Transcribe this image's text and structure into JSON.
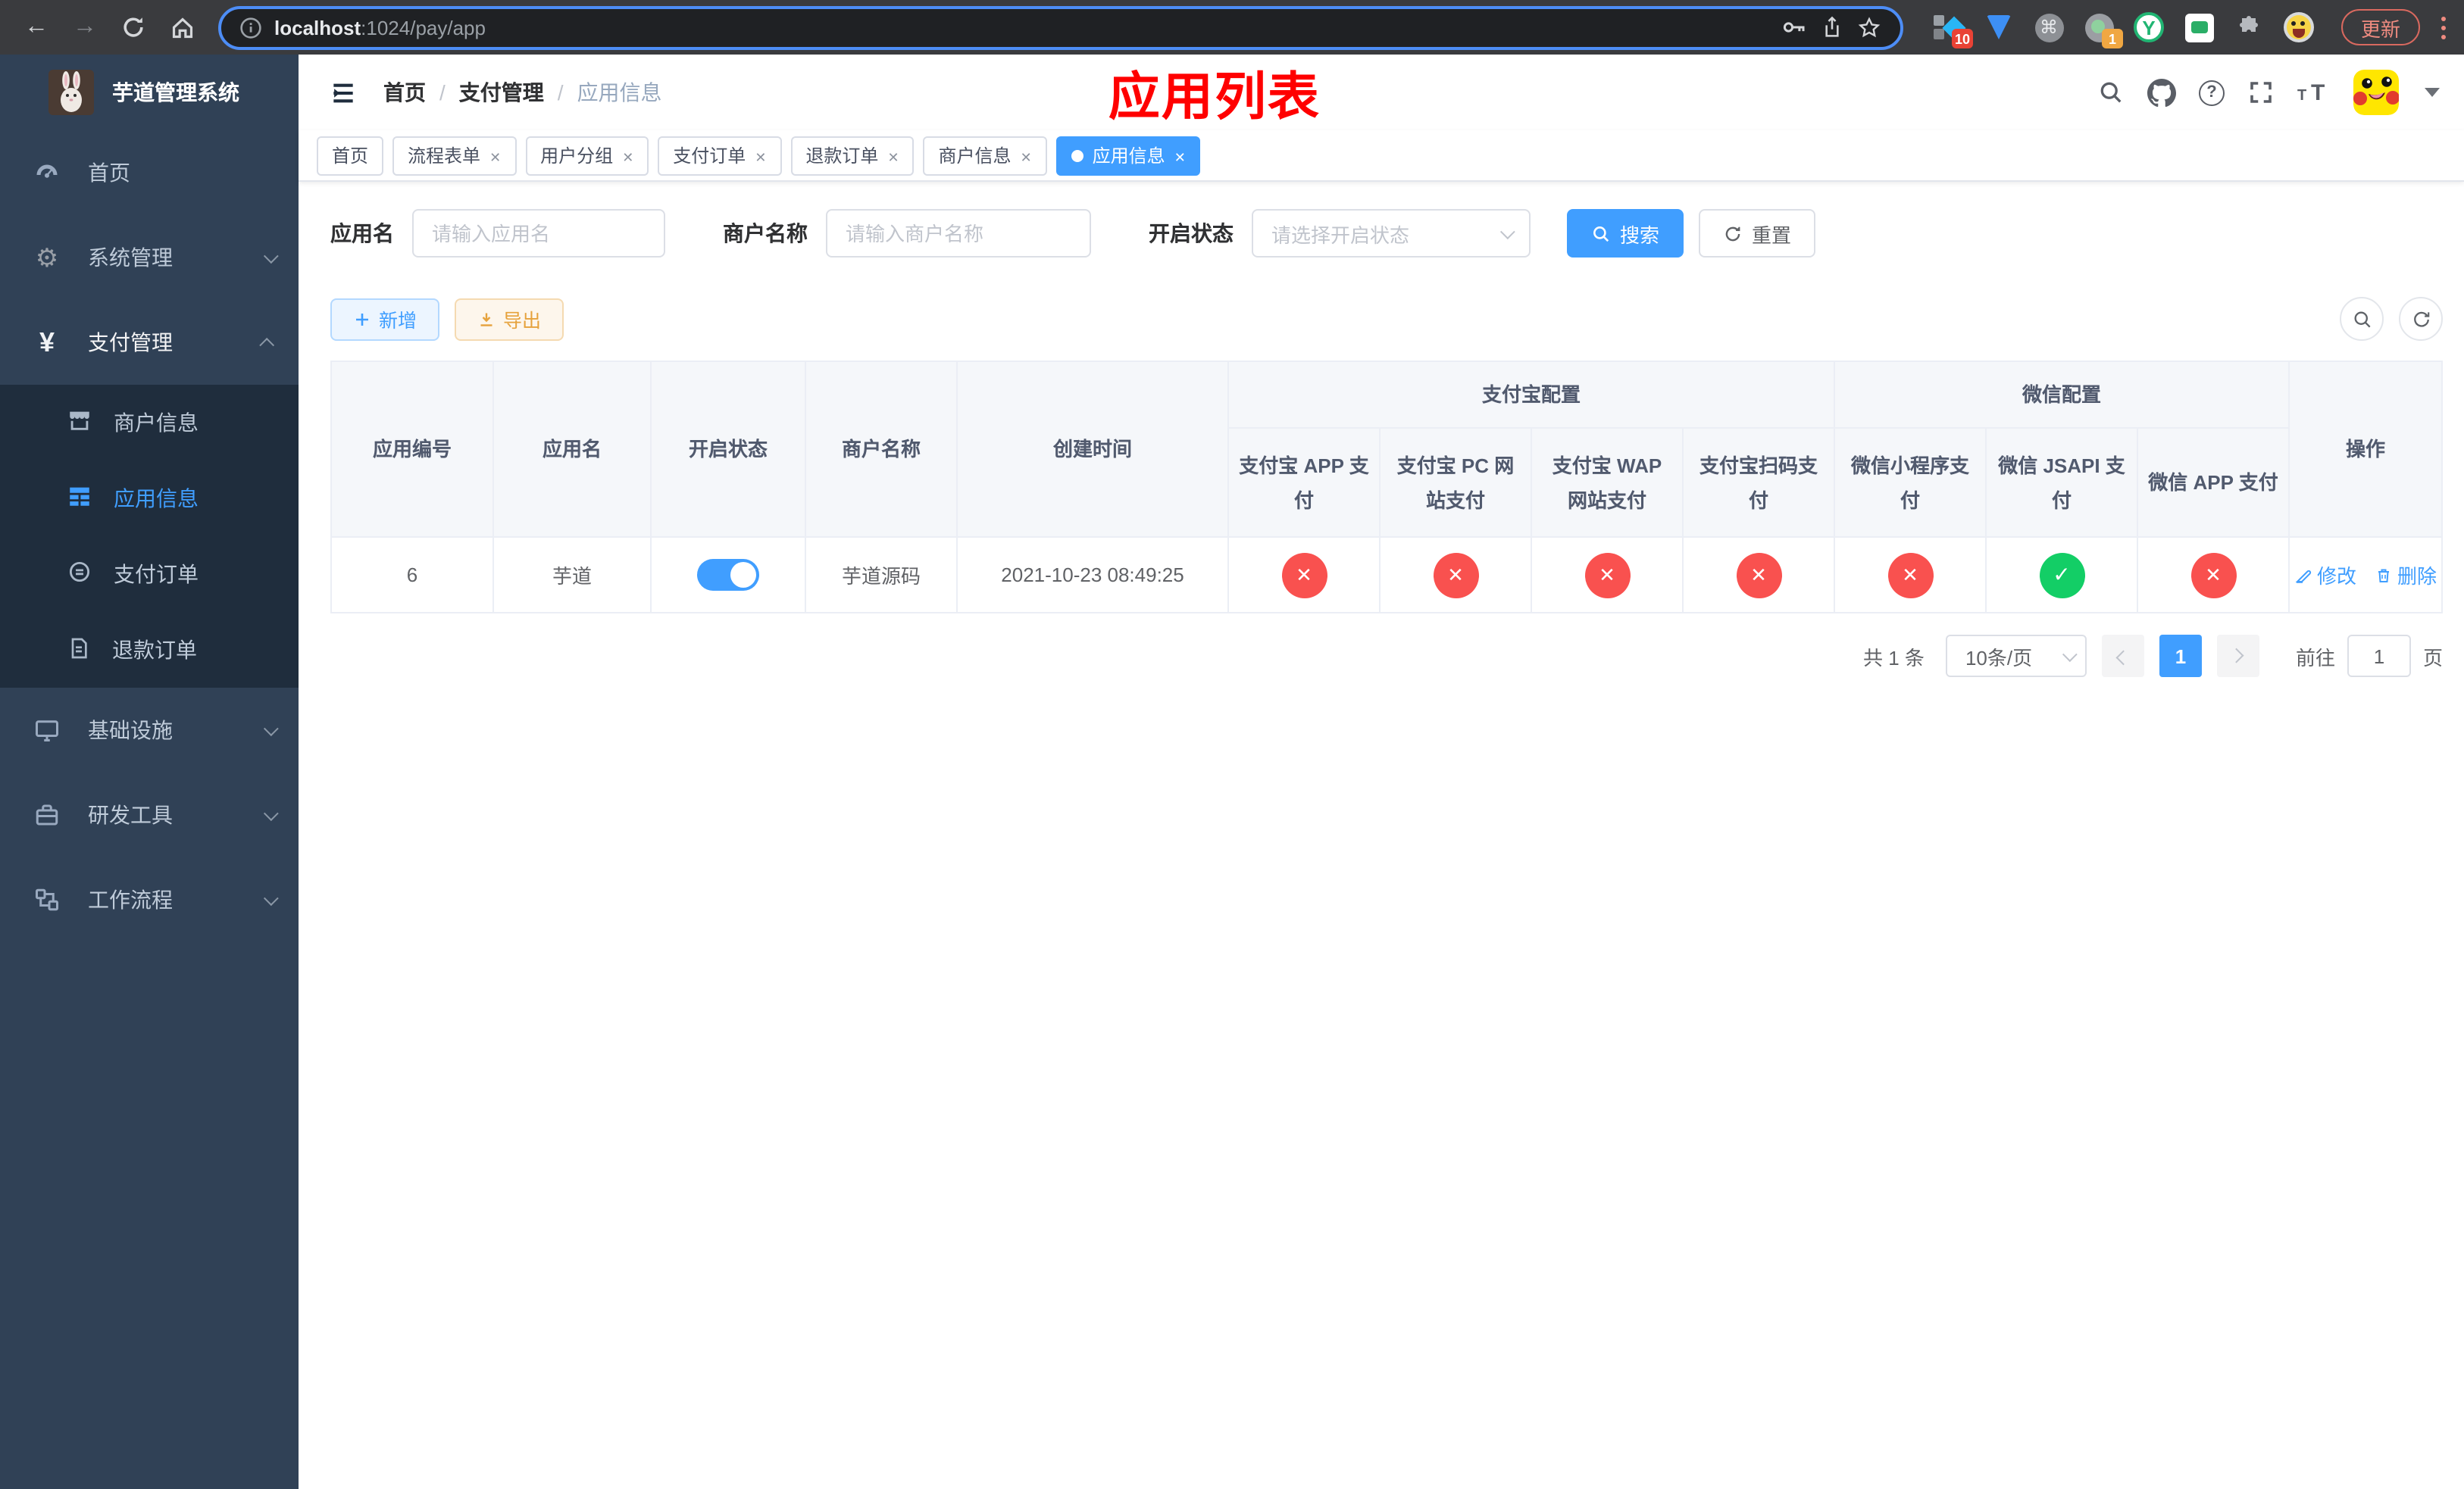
{
  "browser": {
    "url_host": "localhost",
    "url_rest": ":1024/pay/app",
    "ext_badge_blue": "10",
    "ext_badge_gray": "1",
    "update_button": "更新"
  },
  "sidebar": {
    "title": "芋道管理系统",
    "items": [
      {
        "label": "首页"
      },
      {
        "label": "系统管理"
      },
      {
        "label": "支付管理",
        "children": [
          {
            "label": "商户信息"
          },
          {
            "label": "应用信息"
          },
          {
            "label": "支付订单"
          },
          {
            "label": "退款订单"
          }
        ]
      },
      {
        "label": "基础设施"
      },
      {
        "label": "研发工具"
      },
      {
        "label": "工作流程"
      }
    ]
  },
  "header": {
    "breadcrumb": [
      {
        "label": "首页"
      },
      {
        "label": "支付管理"
      },
      {
        "label": "应用信息"
      }
    ],
    "page_title": "应用列表"
  },
  "tabs": [
    {
      "label": "首页"
    },
    {
      "label": "流程表单"
    },
    {
      "label": "用户分组"
    },
    {
      "label": "支付订单"
    },
    {
      "label": "退款订单"
    },
    {
      "label": "商户信息"
    },
    {
      "label": "应用信息"
    }
  ],
  "filters": {
    "app_name_label": "应用名",
    "app_name_placeholder": "请输入应用名",
    "merchant_label": "商户名称",
    "merchant_placeholder": "请输入商户名称",
    "status_label": "开启状态",
    "status_placeholder": "请选择开启状态",
    "search_button": "搜索",
    "reset_button": "重置"
  },
  "toolbar": {
    "add_button": "新增",
    "export_button": "导出"
  },
  "table": {
    "columns": [
      "应用编号",
      "应用名",
      "开启状态",
      "商户名称",
      "创建时间",
      "操作"
    ],
    "group_alipay": "支付宝配置",
    "group_wechat": "微信配置",
    "pay_columns": [
      "支付宝 APP 支付",
      "支付宝 PC 网站支付",
      "支付宝 WAP 网站支付",
      "支付宝扫码支付",
      "微信小程序支付",
      "微信 JSAPI 支付",
      "微信 APP 支付"
    ],
    "rows": [
      {
        "id": "6",
        "name": "芋道",
        "enabled": true,
        "merchant": "芋道源码",
        "created": "2021-10-23 08:49:25",
        "statuses": [
          false,
          false,
          false,
          false,
          false,
          true,
          false
        ],
        "edit_label": "修改",
        "delete_label": "删除"
      }
    ]
  },
  "pagination": {
    "total": "共 1 条",
    "page_size": "10条/页",
    "current_page": "1",
    "goto_label": "前往",
    "goto_value": "1",
    "goto_suffix": "页"
  },
  "colors": {
    "accent": "#409eff",
    "success": "#13ce66",
    "danger": "#f9514f",
    "warning": "#e6a23c",
    "title_red": "#ff0000"
  }
}
